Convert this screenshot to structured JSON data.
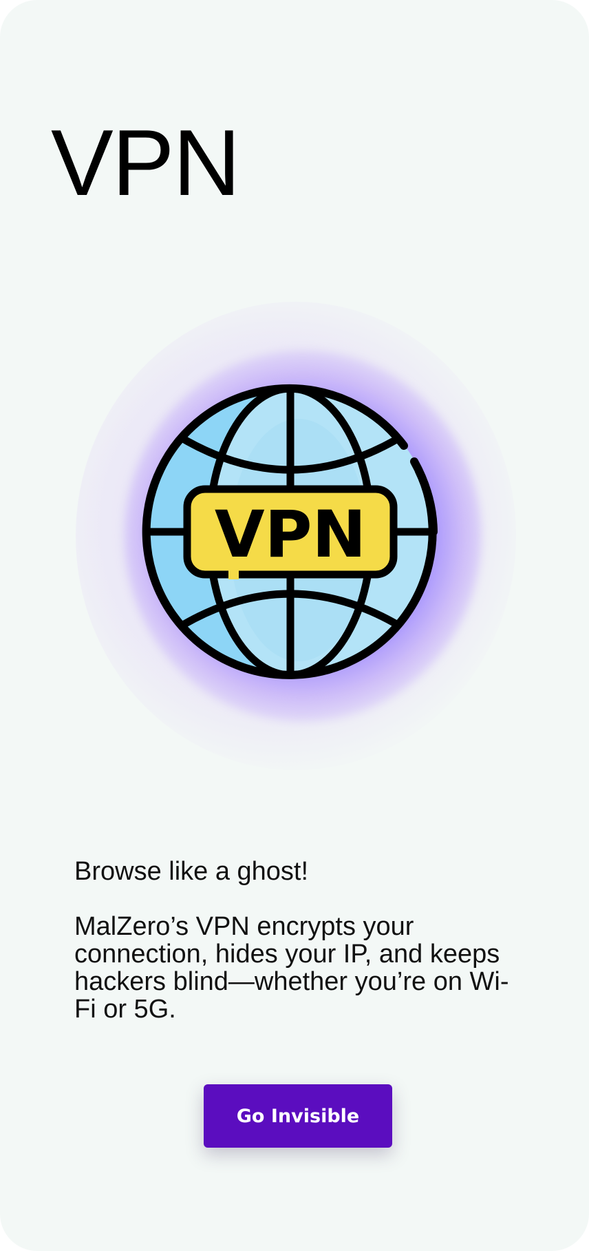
{
  "header": {
    "title": "VPN"
  },
  "hero": {
    "icon": "vpn-globe-icon",
    "badge_text": "VPN",
    "colors": {
      "globe_light": "#b3e3f7",
      "globe_dark": "#8dd5f6",
      "badge": "#f5db48",
      "outline": "#000000",
      "glow": "#8a7dff"
    }
  },
  "body": {
    "tagline": "Browse like a ghost!",
    "description": "MalZero’s VPN encrypts your connection, hides your IP, and keeps hackers blind—whether you’re on Wi-Fi or 5G."
  },
  "cta": {
    "label": "Go Invisible",
    "color": "#5b0dbf"
  }
}
